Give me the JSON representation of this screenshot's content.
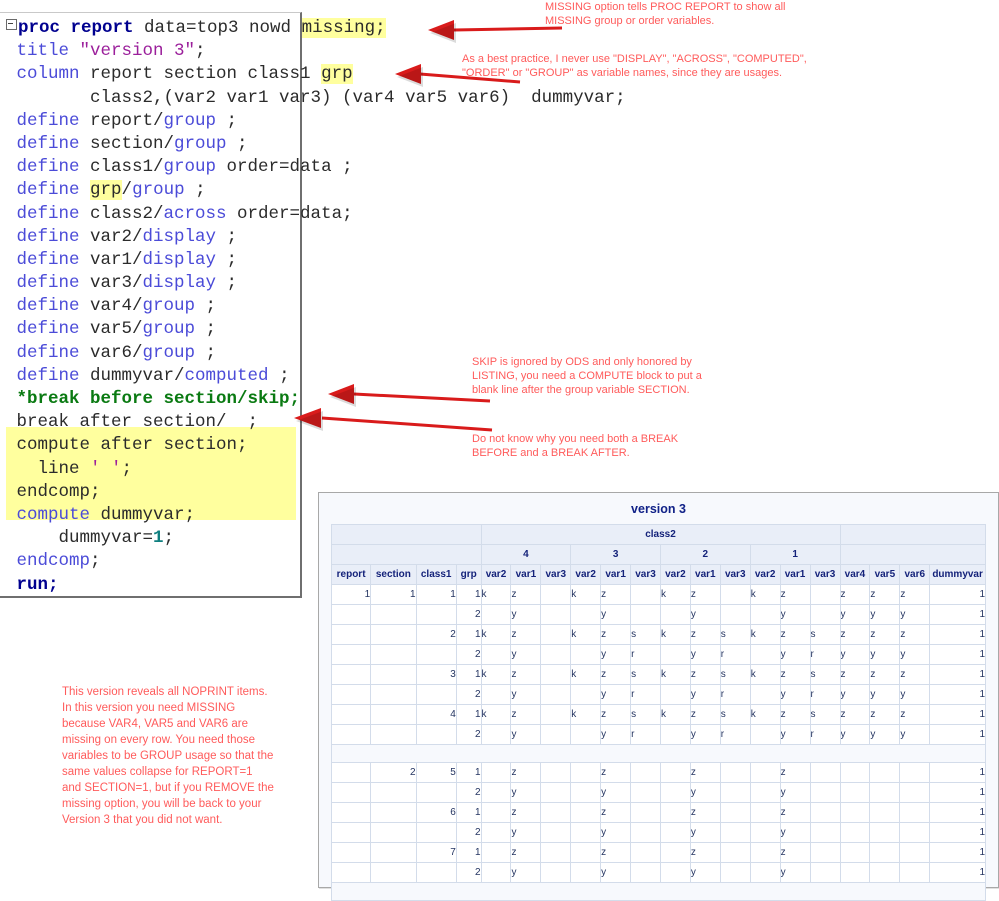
{
  "code": {
    "language": "SAS",
    "lines": [
      {
        "id": "l1",
        "expander": true,
        "tokens": [
          {
            "t": "proc report",
            "c": "kw"
          },
          {
            "t": " data=top3 nowd ",
            "c": "pl"
          },
          {
            "t": "missing;",
            "c": "pl",
            "hl": true
          }
        ]
      },
      {
        "id": "l2",
        "tokens": [
          {
            "t": " title ",
            "c": "blu"
          },
          {
            "t": "\"version 3\"",
            "c": "purp"
          },
          {
            "t": ";",
            "c": "pl"
          }
        ]
      },
      {
        "id": "l3",
        "tokens": [
          {
            "t": " column",
            "c": "blu"
          },
          {
            "t": " report section class1 ",
            "c": "pl"
          },
          {
            "t": "grp",
            "c": "pl",
            "hl": true
          }
        ]
      },
      {
        "id": "l4",
        "tokens": [
          {
            "t": "        class2,(var2 var1 var3) (var4 var5 var6)  dummyvar;",
            "c": "pl"
          }
        ]
      },
      {
        "id": "l5",
        "tokens": [
          {
            "t": " define",
            "c": "blu"
          },
          {
            "t": " report/",
            "c": "pl"
          },
          {
            "t": "group",
            "c": "blu"
          },
          {
            "t": " ;",
            "c": "pl"
          }
        ]
      },
      {
        "id": "l6",
        "tokens": [
          {
            "t": " define",
            "c": "blu"
          },
          {
            "t": " section/",
            "c": "pl"
          },
          {
            "t": "group",
            "c": "blu"
          },
          {
            "t": " ;",
            "c": "pl"
          }
        ]
      },
      {
        "id": "l7",
        "tokens": [
          {
            "t": " define",
            "c": "blu"
          },
          {
            "t": " class1/",
            "c": "pl"
          },
          {
            "t": "group",
            "c": "blu"
          },
          {
            "t": " order=data ;",
            "c": "pl"
          }
        ]
      },
      {
        "id": "l8",
        "tokens": [
          {
            "t": " define",
            "c": "blu"
          },
          {
            "t": " ",
            "c": "pl"
          },
          {
            "t": "grp",
            "c": "pl",
            "hl": true
          },
          {
            "t": "/",
            "c": "pl"
          },
          {
            "t": "group",
            "c": "blu"
          },
          {
            "t": " ;",
            "c": "pl"
          }
        ]
      },
      {
        "id": "l9",
        "tokens": [
          {
            "t": " define",
            "c": "blu"
          },
          {
            "t": " class2/",
            "c": "pl"
          },
          {
            "t": "across",
            "c": "blu"
          },
          {
            "t": " order=data;",
            "c": "pl"
          }
        ]
      },
      {
        "id": "l10",
        "tokens": [
          {
            "t": " define",
            "c": "blu"
          },
          {
            "t": " var2/",
            "c": "pl"
          },
          {
            "t": "display",
            "c": "blu"
          },
          {
            "t": " ;",
            "c": "pl"
          }
        ]
      },
      {
        "id": "l11",
        "tokens": [
          {
            "t": " define",
            "c": "blu"
          },
          {
            "t": " var1/",
            "c": "pl"
          },
          {
            "t": "display",
            "c": "blu"
          },
          {
            "t": " ;",
            "c": "pl"
          }
        ]
      },
      {
        "id": "l12",
        "tokens": [
          {
            "t": " define",
            "c": "blu"
          },
          {
            "t": " var3/",
            "c": "pl"
          },
          {
            "t": "display",
            "c": "blu"
          },
          {
            "t": " ;",
            "c": "pl"
          }
        ]
      },
      {
        "id": "l13",
        "tokens": [
          {
            "t": " define",
            "c": "blu"
          },
          {
            "t": " var4/",
            "c": "pl"
          },
          {
            "t": "group",
            "c": "blu"
          },
          {
            "t": " ;",
            "c": "pl"
          }
        ]
      },
      {
        "id": "l14",
        "tokens": [
          {
            "t": " define",
            "c": "blu"
          },
          {
            "t": " var5/",
            "c": "pl"
          },
          {
            "t": "group",
            "c": "blu"
          },
          {
            "t": " ;",
            "c": "pl"
          }
        ]
      },
      {
        "id": "l15",
        "tokens": [
          {
            "t": " define",
            "c": "blu"
          },
          {
            "t": " var6/",
            "c": "pl"
          },
          {
            "t": "group",
            "c": "blu"
          },
          {
            "t": " ;",
            "c": "pl"
          }
        ]
      },
      {
        "id": "l16",
        "tokens": [
          {
            "t": " define",
            "c": "blu"
          },
          {
            "t": " dummyvar/",
            "c": "pl"
          },
          {
            "t": "computed",
            "c": "blu"
          },
          {
            "t": " ;",
            "c": "pl"
          }
        ]
      },
      {
        "id": "l17",
        "tokens": [
          {
            "t": " *break before section/skip;",
            "c": "grn"
          }
        ]
      },
      {
        "id": "l18",
        "tokens": [
          {
            "t": " break after section/  ;",
            "c": "pl"
          }
        ]
      },
      {
        "id": "l19",
        "tokens": [
          {
            "t": " compute after section;",
            "c": "pl"
          }
        ]
      },
      {
        "id": "l20",
        "tokens": [
          {
            "t": "   line ",
            "c": "pl"
          },
          {
            "t": "' '",
            "c": "purp"
          },
          {
            "t": ";",
            "c": "pl"
          }
        ]
      },
      {
        "id": "l21",
        "tokens": [
          {
            "t": " endcomp;",
            "c": "pl"
          }
        ]
      },
      {
        "id": "l22",
        "tokens": [
          {
            "t": " compute",
            "c": "blu"
          },
          {
            "t": " dummyvar;",
            "c": "pl"
          }
        ]
      },
      {
        "id": "l23",
        "tokens": [
          {
            "t": "     dummyvar=",
            "c": "pl"
          },
          {
            "t": "1",
            "c": "teal"
          },
          {
            "t": ";",
            "c": "pl"
          }
        ]
      },
      {
        "id": "l24",
        "tokens": [
          {
            "t": " endcomp",
            "c": "blu"
          },
          {
            "t": ";",
            "c": "pl"
          }
        ]
      },
      {
        "id": "l25",
        "tokens": [
          {
            "t": " run;",
            "c": "kw"
          }
        ]
      }
    ]
  },
  "annotations": {
    "missing_note": "MISSING option tells PROC REPORT to show all MISSING group or order variables.",
    "naming_note": "As a best practice, I never use \"DISPLAY\", \"ACROSS\", \"COMPUTED\", \"ORDER\" or \"GROUP\" as variable names, since they are usages.",
    "skip_note": "SKIP is ignored by ODS and only honored by LISTING, you need a COMPUTE block to put a blank line after the group variable SECTION.",
    "break_note": "Do not know why you need both a BREAK BEFORE and a BREAK AFTER.",
    "version_note": "This version reveals all NOPRINT items. In this version you need MISSING because VAR4, VAR5 and VAR6 are missing on every row. You need those variables to be GROUP usage so that the same values collapse for REPORT=1 and SECTION=1, but if you REMOVE the missing option, you will be back to your Version 3 that you did not want."
  },
  "output": {
    "title": "version 3",
    "across_group_label": "class2",
    "across_values": [
      "4",
      "3",
      "2",
      "1"
    ],
    "columns": [
      "report",
      "section",
      "class1",
      "grp",
      "var2",
      "var1",
      "var3",
      "var2",
      "var1",
      "var3",
      "var2",
      "var1",
      "var3",
      "var2",
      "var1",
      "var3",
      "var4",
      "var5",
      "var6",
      "dummyvar"
    ],
    "rows": [
      {
        "type": "data",
        "cells": [
          "1",
          "1",
          "1",
          "1",
          "k",
          "z",
          "",
          "k",
          "z",
          "",
          "k",
          "z",
          "",
          "k",
          "z",
          "",
          "z",
          "z",
          "z",
          "1"
        ]
      },
      {
        "type": "data",
        "cells": [
          "",
          "",
          "",
          "2",
          "",
          "y",
          "",
          "",
          "y",
          "",
          "",
          "y",
          "",
          "",
          "y",
          "",
          "y",
          "y",
          "y",
          "1"
        ]
      },
      {
        "type": "data",
        "cells": [
          "",
          "",
          "2",
          "1",
          "k",
          "z",
          "",
          "k",
          "z",
          "s",
          "k",
          "z",
          "s",
          "k",
          "z",
          "s",
          "z",
          "z",
          "z",
          "1"
        ]
      },
      {
        "type": "data",
        "cells": [
          "",
          "",
          "",
          "2",
          "",
          "y",
          "",
          "",
          "y",
          "r",
          "",
          "y",
          "r",
          "",
          "y",
          "r",
          "y",
          "y",
          "y",
          "1"
        ]
      },
      {
        "type": "data",
        "cells": [
          "",
          "",
          "3",
          "1",
          "k",
          "z",
          "",
          "k",
          "z",
          "s",
          "k",
          "z",
          "s",
          "k",
          "z",
          "s",
          "z",
          "z",
          "z",
          "1"
        ]
      },
      {
        "type": "data",
        "cells": [
          "",
          "",
          "",
          "2",
          "",
          "y",
          "",
          "",
          "y",
          "r",
          "",
          "y",
          "r",
          "",
          "y",
          "r",
          "y",
          "y",
          "y",
          "1"
        ]
      },
      {
        "type": "data",
        "cells": [
          "",
          "",
          "4",
          "1",
          "k",
          "z",
          "",
          "k",
          "z",
          "s",
          "k",
          "z",
          "s",
          "k",
          "z",
          "s",
          "z",
          "z",
          "z",
          "1"
        ]
      },
      {
        "type": "data",
        "cells": [
          "",
          "",
          "",
          "2",
          "",
          "y",
          "",
          "",
          "y",
          "r",
          "",
          "y",
          "r",
          "",
          "y",
          "r",
          "y",
          "y",
          "y",
          "1"
        ]
      },
      {
        "type": "spacer",
        "cells": []
      },
      {
        "type": "data",
        "cells": [
          "",
          "2",
          "5",
          "1",
          "",
          "z",
          "",
          "",
          "z",
          "",
          "",
          "z",
          "",
          "",
          "z",
          "",
          "",
          "",
          "",
          "1"
        ]
      },
      {
        "type": "data",
        "cells": [
          "",
          "",
          "",
          "2",
          "",
          "y",
          "",
          "",
          "y",
          "",
          "",
          "y",
          "",
          "",
          "y",
          "",
          "",
          "",
          "",
          "1"
        ]
      },
      {
        "type": "data",
        "cells": [
          "",
          "",
          "6",
          "1",
          "",
          "z",
          "",
          "",
          "z",
          "",
          "",
          "z",
          "",
          "",
          "z",
          "",
          "",
          "",
          "",
          "1"
        ]
      },
      {
        "type": "data",
        "cells": [
          "",
          "",
          "",
          "2",
          "",
          "y",
          "",
          "",
          "y",
          "",
          "",
          "y",
          "",
          "",
          "y",
          "",
          "",
          "",
          "",
          "1"
        ]
      },
      {
        "type": "data",
        "cells": [
          "",
          "",
          "7",
          "1",
          "",
          "z",
          "",
          "",
          "z",
          "",
          "",
          "z",
          "",
          "",
          "z",
          "",
          "",
          "",
          "",
          "1"
        ]
      },
      {
        "type": "data",
        "cells": [
          "",
          "",
          "",
          "2",
          "",
          "y",
          "",
          "",
          "y",
          "",
          "",
          "y",
          "",
          "",
          "y",
          "",
          "",
          "",
          "",
          "1"
        ]
      },
      {
        "type": "spacer",
        "cells": []
      }
    ],
    "numeric_columns": [
      0,
      1,
      2,
      3,
      19
    ]
  },
  "colors": {
    "annotation_red": "#ff5b5b",
    "highlight_yellow": "#ffff9e",
    "keyword_blue": "#00008f",
    "identifier_blue": "#4b4bd8",
    "string_purple": "#9b1f9b",
    "comment_green": "#0a7a12",
    "table_header_bg": "#e9eef8",
    "table_text": "#14227a",
    "arrow_red": "#d91b1b"
  }
}
